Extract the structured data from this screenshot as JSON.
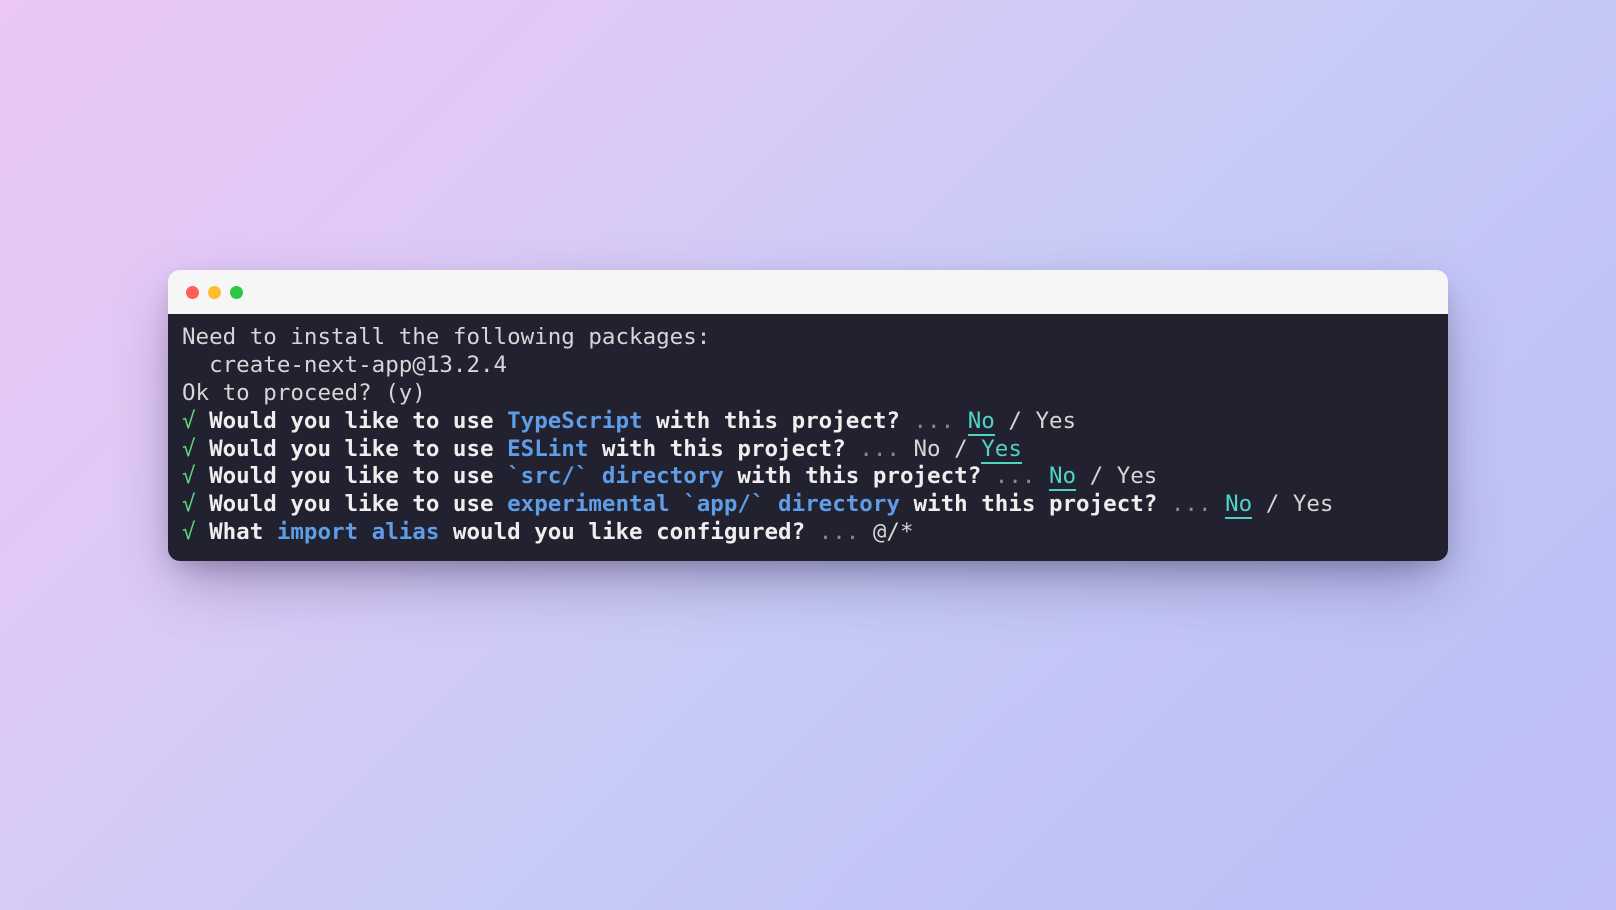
{
  "header": {
    "line1": "Need to install the following packages:",
    "line2": "  create-next-app@13.2.4",
    "line3": "Ok to proceed? (y)"
  },
  "check": "√",
  "dots": "...",
  "slash": " / ",
  "prompts": [
    {
      "pre": "Would you like to use ",
      "hl": "TypeScript",
      "post": " with this project?",
      "opt_no": "No",
      "opt_yes": "Yes",
      "selected": "no"
    },
    {
      "pre": "Would you like to use ",
      "hl": "ESLint",
      "post": " with this project?",
      "opt_no": "No",
      "opt_yes": "Yes",
      "selected": "yes"
    },
    {
      "pre": "Would you like to use ",
      "hl": "`src/` directory",
      "post": " with this project?",
      "opt_no": "No",
      "opt_yes": "Yes",
      "selected": "no"
    },
    {
      "pre": "Would you like to use ",
      "hl": "experimental `app/` directory",
      "post": " with this project?",
      "opt_no": "No",
      "opt_yes": "Yes",
      "selected": "no"
    }
  ],
  "alias": {
    "pre": "What ",
    "hl": "import alias",
    "post": " would you like configured?",
    "value": "@/*"
  }
}
